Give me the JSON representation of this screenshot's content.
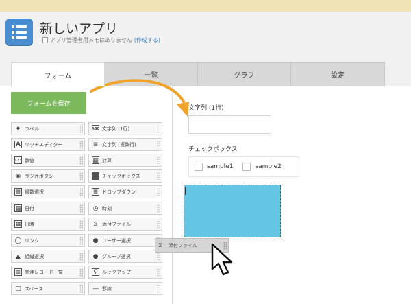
{
  "app": {
    "title": "新しいアプリ",
    "memo_text": "アプリ管理者用メモはありません",
    "memo_link": "(作成する)"
  },
  "tabs": [
    {
      "label": "フォーム",
      "active": true
    },
    {
      "label": "一覧",
      "active": false
    },
    {
      "label": "グラフ",
      "active": false
    },
    {
      "label": "設定",
      "active": false
    }
  ],
  "toolbar": {
    "save_label": "フォームを保存"
  },
  "palette": {
    "left": [
      {
        "label": "ラベル",
        "icon": "tag-icon"
      },
      {
        "label": "リッチエディター",
        "icon": "rich-editor-icon"
      },
      {
        "label": "数値",
        "icon": "number-icon"
      },
      {
        "label": "ラジオボタン",
        "icon": "radio-icon"
      },
      {
        "label": "複数選択",
        "icon": "multi-select-icon"
      },
      {
        "label": "日付",
        "icon": "calendar-icon"
      },
      {
        "label": "日時",
        "icon": "datetime-icon"
      },
      {
        "label": "リンク",
        "icon": "globe-icon"
      },
      {
        "label": "組織選択",
        "icon": "org-icon"
      },
      {
        "label": "関連レコード一覧",
        "icon": "related-records-icon"
      },
      {
        "label": "スペース",
        "icon": "space-icon"
      }
    ],
    "right": [
      {
        "label": "文字列 (1行)",
        "icon": "text-single-icon"
      },
      {
        "label": "文字列 (複数行)",
        "icon": "text-multi-icon"
      },
      {
        "label": "計算",
        "icon": "calculator-icon"
      },
      {
        "label": "チェックボックス",
        "icon": "checkbox-icon"
      },
      {
        "label": "ドロップダウン",
        "icon": "dropdown-icon"
      },
      {
        "label": "時刻",
        "icon": "clock-icon"
      },
      {
        "label": "添付ファイル",
        "icon": "paperclip-icon"
      },
      {
        "label": "ユーザー選択",
        "icon": "user-icon"
      },
      {
        "label": "グループ選択",
        "icon": "group-icon"
      },
      {
        "label": "ルックアップ",
        "icon": "lookup-icon"
      },
      {
        "label": "罫線",
        "icon": "line-icon"
      }
    ]
  },
  "form": {
    "text_field_label": "文字列 (1行)",
    "checkbox_label": "チェックボックス",
    "checkbox_options": [
      "sample1",
      "sample2"
    ]
  },
  "drag": {
    "label": "添付ファイル",
    "icon": "paperclip-icon"
  },
  "colors": {
    "accent_green": "#7cb95d",
    "drop_blue": "#64c6e3",
    "arrow_orange": "#f0a22a",
    "app_icon_blue": "#4a8ed1"
  }
}
